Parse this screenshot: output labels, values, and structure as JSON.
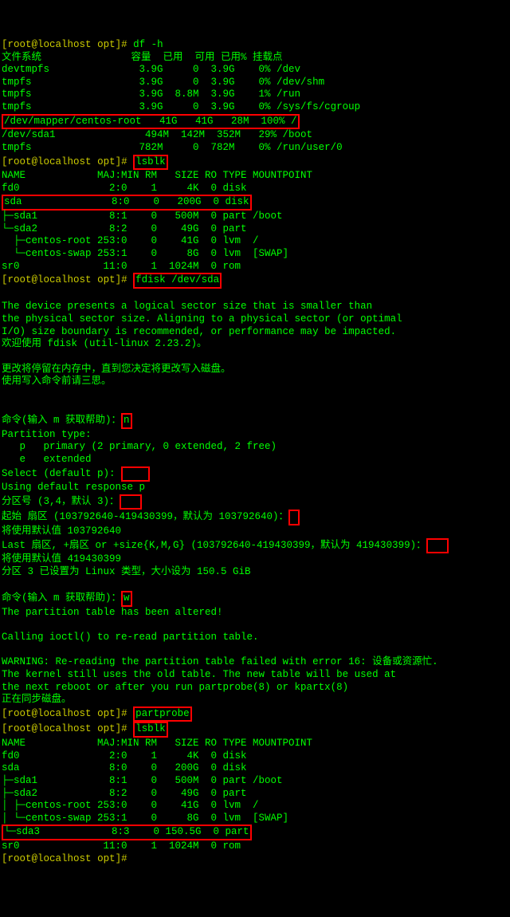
{
  "prompt": {
    "user": "root",
    "host": "localhost",
    "path": "opt",
    "symbol": "#"
  },
  "cmds": {
    "df": "df -h",
    "lsblk": "lsblk",
    "fdisk": "fdisk /dev/sda",
    "partprobe": "partprobe"
  },
  "df": {
    "header": "文件系统               容量  已用  可用 已用% 挂载点",
    "rows": [
      "devtmpfs               3.9G     0  3.9G    0% /dev",
      "tmpfs                  3.9G     0  3.9G    0% /dev/shm",
      "tmpfs                  3.9G  8.8M  3.9G    1% /run",
      "tmpfs                  3.9G     0  3.9G    0% /sys/fs/cgroup",
      "/dev/mapper/centos-root   41G   41G   28M  100% /",
      "/dev/sda1               494M  142M  352M   29% /boot",
      "tmpfs                  782M     0  782M    0% /run/user/0"
    ]
  },
  "lsblk1": {
    "header": "NAME            MAJ:MIN RM   SIZE RO TYPE MOUNTPOINT",
    "rows": [
      "fd0               2:0    1     4K  0 disk",
      "sda               8:0    0   200G  0 disk",
      "├─sda1            8:1    0   500M  0 part /boot",
      "└─sda2            8:2    0    49G  0 part",
      "  ├─centos-root 253:0    0    41G  0 lvm  /",
      "  └─centos-swap 253:1    0     8G  0 lvm  [SWAP]",
      "sr0              11:0    1  1024M  0 rom"
    ]
  },
  "fdisk": {
    "intro1": "The device presents a logical sector size that is smaller than",
    "intro2": "the physical sector size. Aligning to a physical sector (or optimal",
    "intro3": "I/O) size boundary is recommended, or performance may be impacted.",
    "intro4": "欢迎使用 fdisk (util-linux 2.23.2)。",
    "warn1": "更改将停留在内存中，直到您决定将更改写入磁盘。",
    "warn2": "使用写入命令前请三思。",
    "cmd_prompt": "命令(输入 m 获取帮助)：",
    "n": "n",
    "ptype": "Partition type:",
    "ptype_p": "   p   primary (2 primary, 0 extended, 2 free)",
    "ptype_e": "   e   extended",
    "select": "Select (default p): ",
    "select_empty": "    ",
    "default_p": "Using default response p",
    "partnum": "分区号 (3,4，默认 3)：",
    "partnum_empty": "   ",
    "first": "起始 扇区 (103792640-419430399，默认为 103792640)：",
    "first_empty": " ",
    "use_default1": "将使用默认值 103792640",
    "last": "Last 扇区, +扇区 or +size{K,M,G} (103792640-419430399，默认为 419430399)：",
    "last_empty": "   ",
    "use_default2": "将使用默认值 419430399",
    "created": "分区 3 已设置为 Linux 类型，大小设为 150.5 GiB",
    "w": "w",
    "altered": "The partition table has been altered!",
    "ioctl": "Calling ioctl() to re-read partition table.",
    "rewarn1": "WARNING: Re-reading the partition table failed with error 16: 设备或资源忙.",
    "rewarn2": "The kernel still uses the old table. The new table will be used at",
    "rewarn3": "the next reboot or after you run partprobe(8) or kpartx(8)",
    "syncing": "正在同步磁盘。"
  },
  "lsblk2": {
    "header": "NAME            MAJ:MIN RM   SIZE RO TYPE MOUNTPOINT",
    "rows": [
      "fd0               2:0    1     4K  0 disk",
      "sda               8:0    0   200G  0 disk",
      "├─sda1            8:1    0   500M  0 part /boot",
      "├─sda2            8:2    0    49G  0 part",
      "│ ├─centos-root 253:0    0    41G  0 lvm  /",
      "│ └─centos-swap 253:1    0     8G  0 lvm  [SWAP]",
      "└─sda3            8:3    0 150.5G  0 part",
      "sr0              11:0    1  1024M  0 rom"
    ]
  }
}
